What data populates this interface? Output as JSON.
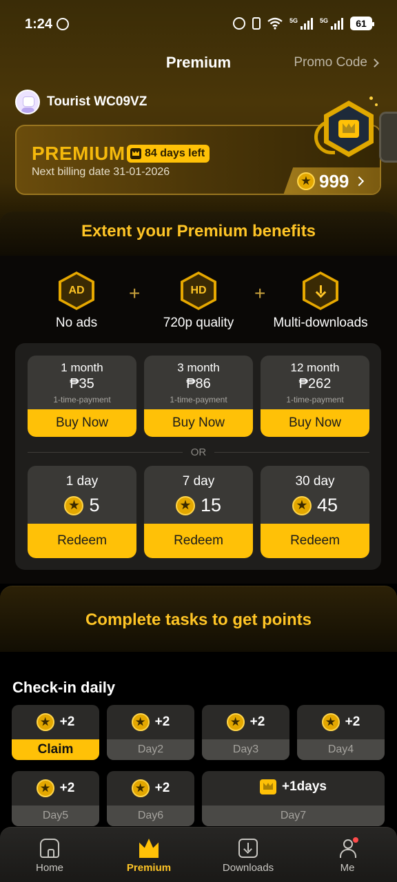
{
  "status_bar": {
    "time": "1:24",
    "network_1": "5G",
    "network_2": "5G",
    "battery": "61"
  },
  "header": {
    "title": "Premium",
    "promo_code": "Promo Code"
  },
  "user": {
    "name": "Tourist WC09VZ"
  },
  "premium_card": {
    "title": "PREMIUM",
    "days_left": "84 days left",
    "billing": "Next billing date 31-01-2026",
    "points": "999"
  },
  "benefits": {
    "title": "Extent your Premium benefits",
    "items": [
      {
        "icon": "AD",
        "label": "No ads"
      },
      {
        "icon": "HD",
        "label": "720p quality"
      },
      {
        "icon": "download",
        "label": "Multi-downloads"
      }
    ],
    "plus": "+"
  },
  "plans": [
    {
      "duration": "1 month",
      "price": "₱35",
      "note": "1-time-payment",
      "button": "Buy Now"
    },
    {
      "duration": "3 month",
      "price": "₱86",
      "note": "1-time-payment",
      "button": "Buy Now"
    },
    {
      "duration": "12 month",
      "price": "₱262",
      "note": "1-time-payment",
      "button": "Buy Now"
    }
  ],
  "or_label": "OR",
  "redeem": [
    {
      "duration": "1 day",
      "cost": "5",
      "button": "Redeem"
    },
    {
      "duration": "7 day",
      "cost": "15",
      "button": "Redeem"
    },
    {
      "duration": "30 day",
      "cost": "45",
      "button": "Redeem"
    }
  ],
  "tasks": {
    "title": "Complete tasks to get points",
    "checkin_title": "Check-in daily",
    "days": [
      {
        "points": "+2",
        "label": "Claim"
      },
      {
        "points": "+2",
        "label": "Day2"
      },
      {
        "points": "+2",
        "label": "Day3"
      },
      {
        "points": "+2",
        "label": "Day4"
      },
      {
        "points": "+2",
        "label": "Day5"
      },
      {
        "points": "+2",
        "label": "Day6"
      },
      {
        "points": "+1days",
        "label": "Day7"
      }
    ]
  },
  "nav": {
    "home": "Home",
    "premium": "Premium",
    "downloads": "Downloads",
    "me": "Me"
  },
  "colors": {
    "accent": "#ffc107",
    "title_gold": "#ffc526",
    "background": "#000000"
  }
}
